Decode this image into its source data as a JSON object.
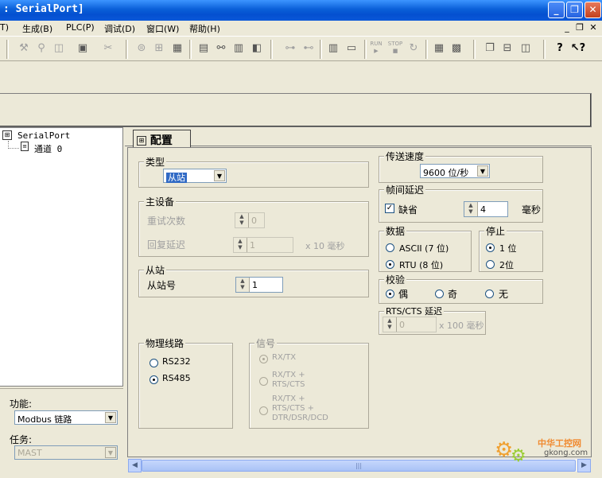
{
  "window": {
    "title": ": SerialPort]",
    "buttons": {
      "minimize": "_",
      "restore": "❐",
      "close": "✕"
    }
  },
  "menu": {
    "items": [
      "T)",
      "生成(B)",
      "PLC(P)",
      "调试(D)",
      "窗口(W)",
      "帮助(H)"
    ],
    "mdi": {
      "minimize": "_",
      "restore": "❐",
      "close": "✕"
    }
  },
  "toolbar": {
    "icons": [
      "wrench-icon",
      "search-icon",
      "zoom-icon",
      "monitor-icon",
      "cut-icon",
      "layers-icon",
      "grid-icon",
      "table-icon",
      "ladder-icon",
      "binoculars-icon",
      "list-icon",
      "window-icon",
      "network-icon",
      "network2-icon",
      "plc-icon",
      "screen-icon",
      "run-icon",
      "stop-icon",
      "refresh-icon",
      "io-icon",
      "chip-icon",
      "cascade-icon",
      "tile-h-icon",
      "tile-v-icon",
      "help-icon",
      "context-help-icon"
    ],
    "run_label": "RUN",
    "stop_label": "STOP"
  },
  "tree": {
    "root": "SerialPort",
    "child": "通道 0"
  },
  "left_panel": {
    "function_label": "功能:",
    "function_value": "Modbus 链路",
    "task_label": "任务:",
    "task_value": "MAST"
  },
  "tab": {
    "label": "配置"
  },
  "type_group": {
    "legend": "类型",
    "value": "从站"
  },
  "master_group": {
    "legend": "主设备",
    "retry_label": "重试次数",
    "retry_value": "0",
    "reply_delay_label": "回复延迟",
    "reply_delay_value": "1",
    "reply_delay_unit": "x 10 毫秒"
  },
  "slave_group": {
    "legend": "从站",
    "slave_no_label": "从站号",
    "slave_no_value": "1"
  },
  "physical_group": {
    "legend": "物理线路",
    "options": [
      "RS232",
      "RS485"
    ],
    "selected": "RS485"
  },
  "signal_group": {
    "legend": "信号",
    "options": [
      "RX/TX",
      "RX/TX +\nRTS/CTS",
      "RX/TX +\nRTS/CTS +\nDTR/DSR/DCD"
    ]
  },
  "speed_group": {
    "legend": "传送速度",
    "value": "9600 位/秒"
  },
  "frame_delay_group": {
    "legend": "帧间延迟",
    "default_label": "缺省",
    "default_checked": true,
    "value": "4",
    "unit": "毫秒"
  },
  "data_group": {
    "legend": "数据",
    "options": [
      "ASCII (7 位)",
      "RTU (8 位)"
    ],
    "selected": "RTU (8 位)"
  },
  "stop_group": {
    "legend": "停止",
    "options": [
      "1 位",
      "2位"
    ],
    "selected": "1 位"
  },
  "parity_group": {
    "legend": "校验",
    "options": [
      "偶",
      "奇",
      "无"
    ],
    "selected": "偶"
  },
  "rtscts_group": {
    "legend": "RTS/CTS 延迟",
    "value": "0",
    "unit": "x 100 毫秒"
  },
  "watermark": {
    "line1": "中华工控网",
    "line2": "gkong.com"
  },
  "colors": {
    "titlebar": "#0a5fd8",
    "background": "#ece9d8",
    "scrollbar": "#c1d3fb"
  }
}
